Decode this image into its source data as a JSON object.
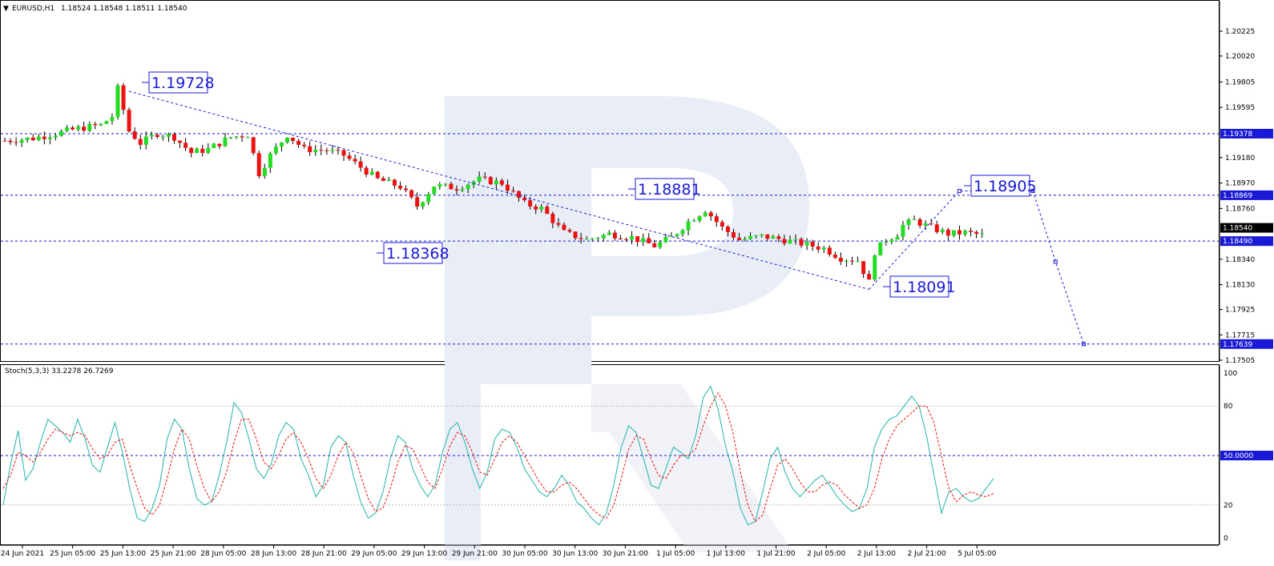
{
  "header": {
    "symbol": "EURUSD,H1",
    "ohlc": "1.18524 1.18548 1.18511 1.18540"
  },
  "osc_header": "Stoch(5,3,3) 33.2278 26.7269",
  "colors": {
    "bull": "#22dd22",
    "bear": "#ee1111",
    "level_line": "#1a1ad6",
    "stoch_main": "#20b2aa",
    "stoch_signal": "#ee1111",
    "watermark": "#e8edf6"
  },
  "chart_data": [
    {
      "type": "candlestick",
      "symbol": "EURUSD",
      "timeframe": "H1",
      "ylim": [
        1.175,
        1.2043
      ],
      "y_ticks": [
        "1.20225",
        "1.20020",
        "1.19805",
        "1.19595",
        "1.19180",
        "1.18970",
        "1.18760",
        "1.18340",
        "1.18130",
        "1.17925",
        "1.17715",
        "1.17505"
      ],
      "x_ticks": [
        "24 Jun 2021",
        "25 Jun 05:00",
        "25 Jun 13:00",
        "25 Jun 21:00",
        "28 Jun 05:00",
        "28 Jun 13:00",
        "28 Jun 21:00",
        "29 Jun 05:00",
        "29 Jun 13:00",
        "29 Jun 21:00",
        "30 Jun 05:00",
        "30 Jun 13:00",
        "30 Jun 21:00",
        "1 Jul 05:00",
        "1 Jul 13:00",
        "1 Jul 21:00",
        "2 Jul 05:00",
        "2 Jul 13:00",
        "2 Jul 21:00",
        "5 Jul 05:00"
      ],
      "horizontal_levels": [
        {
          "price": 1.19378,
          "label": "1.19378"
        },
        {
          "price": 1.18869,
          "label": "1.18869"
        },
        {
          "price": 1.1849,
          "label": "1.18490"
        },
        {
          "price": 1.17639,
          "label": "1.17639"
        }
      ],
      "current_price": "1.18540",
      "annotations": [
        {
          "label": "1.19728",
          "price": 1.19728
        },
        {
          "label": "1.18881",
          "price": 1.18881
        },
        {
          "label": "1.18368",
          "price": 1.18368
        },
        {
          "label": "1.18091",
          "price": 1.18091
        },
        {
          "label": "1.18905",
          "price": 1.18905
        }
      ],
      "close_path": [
        [
          0,
          1.1932
        ],
        [
          5,
          1.1934
        ],
        [
          9,
          1.1938
        ],
        [
          13,
          1.1942
        ],
        [
          17,
          1.1945
        ],
        [
          19,
          1.1952
        ],
        [
          20,
          1.1975
        ],
        [
          22,
          1.194
        ],
        [
          24,
          1.193
        ],
        [
          27,
          1.1938
        ],
        [
          30,
          1.1935
        ],
        [
          33,
          1.1922
        ],
        [
          36,
          1.1925
        ],
        [
          40,
          1.1935
        ],
        [
          43,
          1.1937
        ],
        [
          45,
          1.1905
        ],
        [
          47,
          1.192
        ],
        [
          50,
          1.1937
        ],
        [
          53,
          1.1925
        ],
        [
          57,
          1.1924
        ],
        [
          60,
          1.192
        ],
        [
          63,
          1.191
        ],
        [
          66,
          1.19
        ],
        [
          70,
          1.1894
        ],
        [
          73,
          1.1878
        ],
        [
          76,
          1.1895
        ],
        [
          80,
          1.1893
        ],
        [
          84,
          1.19
        ],
        [
          88,
          1.1897
        ],
        [
          92,
          1.188
        ],
        [
          95,
          1.1876
        ],
        [
          99,
          1.1856
        ],
        [
          103,
          1.185
        ],
        [
          107,
          1.1855
        ],
        [
          111,
          1.1852
        ],
        [
          115,
          1.1845
        ],
        [
          118,
          1.1852
        ],
        [
          121,
          1.1865
        ],
        [
          124,
          1.1875
        ],
        [
          127,
          1.186
        ],
        [
          130,
          1.185
        ],
        [
          134,
          1.1853
        ],
        [
          138,
          1.185
        ],
        [
          142,
          1.1846
        ],
        [
          145,
          1.1843
        ],
        [
          148,
          1.1835
        ],
        [
          151,
          1.1833
        ],
        [
          153,
          1.1815
        ],
        [
          154,
          1.184
        ],
        [
          156,
          1.185
        ],
        [
          158,
          1.1855
        ],
        [
          159,
          1.1862
        ],
        [
          161,
          1.1866
        ],
        [
          164,
          1.186
        ],
        [
          167,
          1.1855
        ],
        [
          170,
          1.1856
        ],
        [
          173,
          1.1854
        ]
      ],
      "candle_count": 174
    },
    {
      "type": "line",
      "name": "Stoch(5,3,3)",
      "values_shown": [
        "33.2278",
        "26.7269"
      ],
      "ylim": [
        0,
        100
      ],
      "y_ticks": [
        "100",
        "80",
        "20",
        "0"
      ],
      "levels": [
        {
          "value": 50,
          "label": "50.0000"
        }
      ],
      "series": [
        {
          "values": [
            20,
            45,
            65,
            35,
            42,
            58,
            72,
            68,
            64,
            58,
            72,
            60,
            44,
            40,
            55,
            70,
            52,
            30,
            12,
            10,
            18,
            32,
            60,
            72,
            66,
            42,
            24,
            20,
            22,
            38,
            58,
            82,
            76,
            60,
            42,
            36,
            45,
            62,
            70,
            66,
            48,
            38,
            25,
            32,
            55,
            62,
            58,
            38,
            22,
            12,
            15,
            28,
            48,
            62,
            58,
            42,
            32,
            25,
            32,
            52,
            66,
            70,
            58,
            42,
            30,
            40,
            60,
            66,
            64,
            55,
            42,
            35,
            28,
            25,
            30,
            38,
            32,
            22,
            18,
            12,
            8,
            15,
            32,
            55,
            68,
            64,
            48,
            32,
            30,
            42,
            55,
            52,
            48,
            62,
            85,
            92,
            78,
            56,
            40,
            18,
            8,
            10,
            28,
            48,
            55,
            40,
            30,
            25,
            30,
            35,
            38,
            32,
            25,
            20,
            16,
            18,
            30,
            55,
            66,
            72,
            74,
            80,
            86,
            80,
            62,
            38,
            15,
            28,
            30,
            25,
            22,
            24,
            30,
            36
          ]
        },
        {
          "values": [
            30,
            38,
            52,
            50,
            46,
            52,
            60,
            66,
            64,
            62,
            64,
            62,
            54,
            48,
            50,
            58,
            60,
            44,
            30,
            18,
            14,
            20,
            36,
            54,
            66,
            60,
            44,
            30,
            22,
            28,
            40,
            58,
            72,
            72,
            60,
            46,
            42,
            50,
            60,
            64,
            58,
            48,
            36,
            30,
            38,
            50,
            58,
            52,
            38,
            24,
            16,
            18,
            30,
            46,
            56,
            54,
            44,
            34,
            30,
            42,
            56,
            64,
            62,
            52,
            40,
            38,
            48,
            58,
            62,
            58,
            50,
            42,
            34,
            28,
            28,
            32,
            34,
            30,
            24,
            18,
            14,
            12,
            20,
            36,
            54,
            62,
            60,
            48,
            38,
            36,
            44,
            50,
            50,
            54,
            68,
            80,
            88,
            80,
            64,
            40,
            20,
            10,
            14,
            30,
            44,
            48,
            42,
            34,
            28,
            28,
            32,
            34,
            32,
            26,
            22,
            18,
            20,
            30,
            48,
            60,
            68,
            72,
            76,
            80,
            80,
            70,
            50,
            30,
            22,
            26,
            28,
            26,
            25,
            27
          ]
        }
      ]
    }
  ]
}
